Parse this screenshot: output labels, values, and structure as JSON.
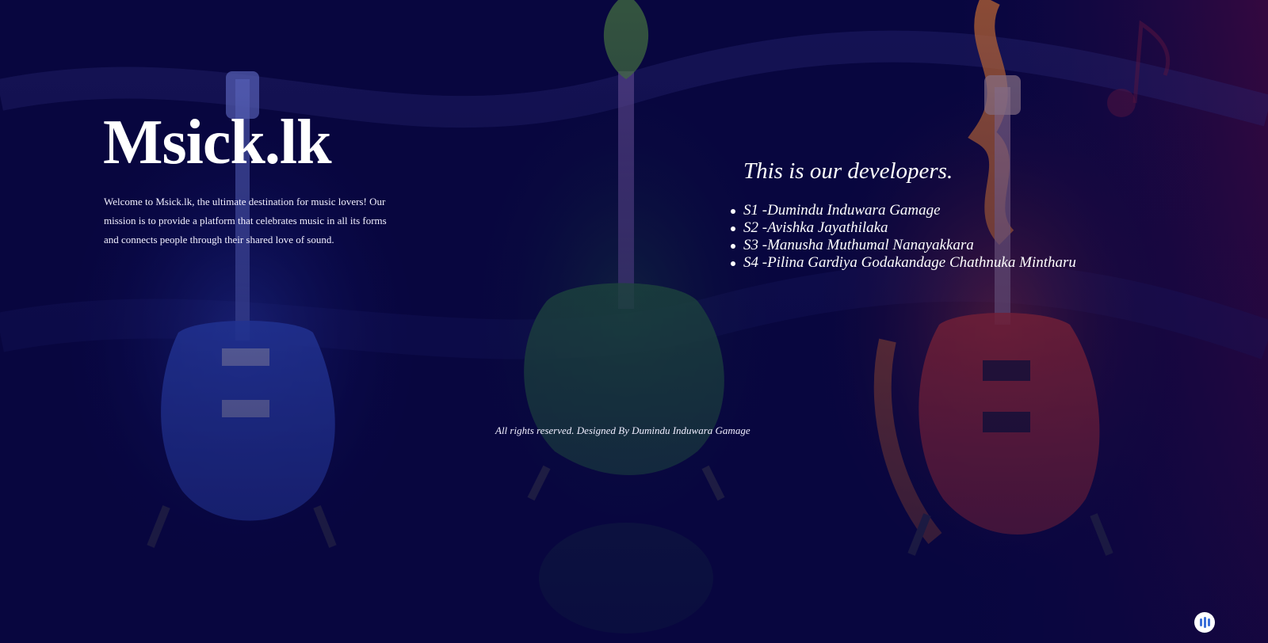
{
  "brand": {
    "title": "Msick.lk"
  },
  "welcome": {
    "text": "Welcome to Msick.lk, the ultimate destination for music lovers! Our mission is to provide a platform that celebrates music in all its forms and connects people through their shared love of sound."
  },
  "developers": {
    "heading": "This is our developers.",
    "items": [
      "S1 -Dumindu Induwara Gamage",
      "S2 -Avishka Jayathilaka",
      "S3 -Manusha Muthumal Nanayakkara",
      "S4 -Pilina Gardiya Godakandage Chathnuka Mintharu"
    ]
  },
  "footer": {
    "text": "All rights reserved. Designed By Dumindu Induwara Gamage"
  },
  "widget": {
    "icon": "audio-bars-icon"
  },
  "colors": {
    "background": "#07063a",
    "water_guitar": "#3f6ef0",
    "leaf_guitar": "#2f8a3a",
    "fire_guitar": "#e0462a"
  }
}
